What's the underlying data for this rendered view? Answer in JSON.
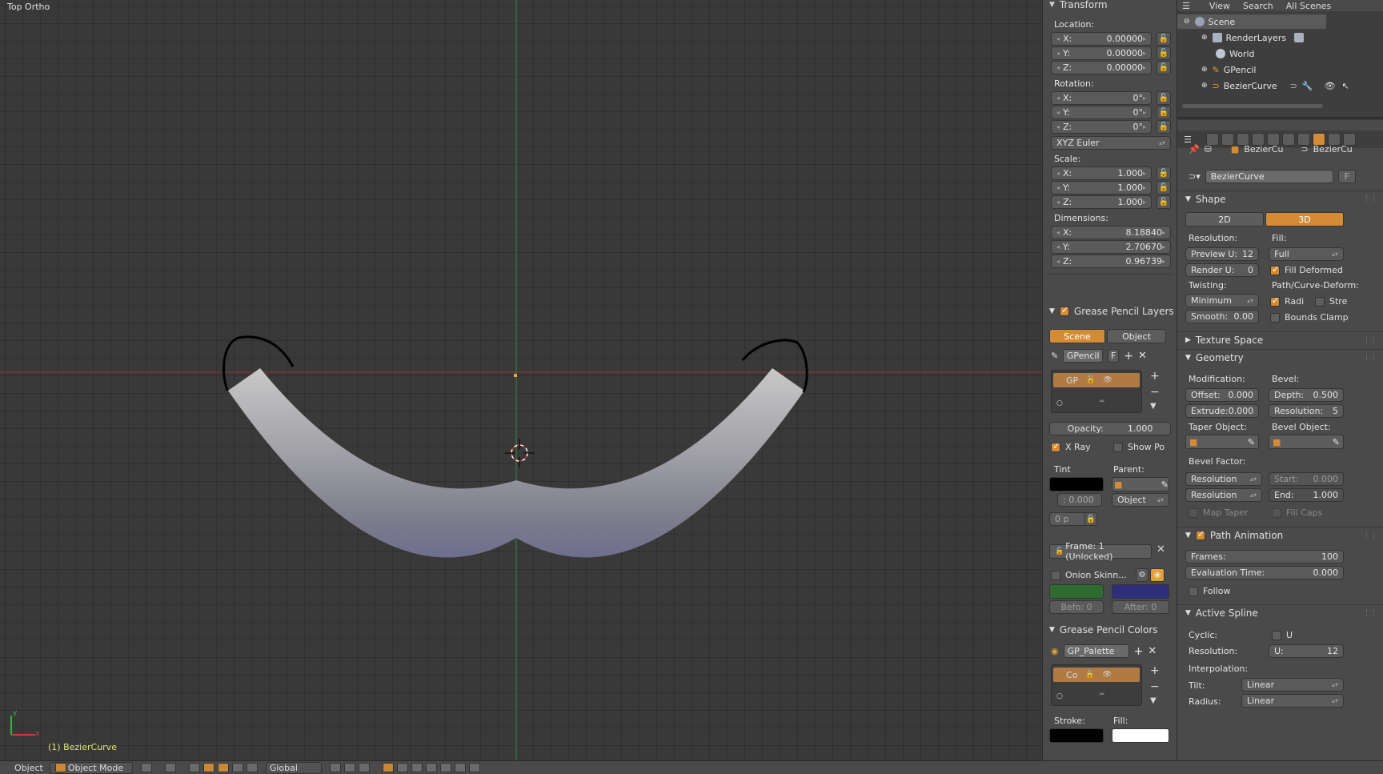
{
  "viewport": {
    "view_label": "Top Ortho",
    "object_label": "(1) BezierCurve",
    "axis_y": "y",
    "axis_x": "x"
  },
  "bottombar": {
    "menu_object": "Object",
    "mode": "Object Mode",
    "orientation": "Global"
  },
  "npanel": {
    "transform_title": "Transform",
    "location_label": "Location:",
    "location": [
      {
        "axis": "X:",
        "value": "0.00000"
      },
      {
        "axis": "Y:",
        "value": "0.00000"
      },
      {
        "axis": "Z:",
        "value": "0.00000"
      }
    ],
    "rotation_label": "Rotation:",
    "rotation": [
      {
        "axis": "X:",
        "value": "0°"
      },
      {
        "axis": "Y:",
        "value": "0°"
      },
      {
        "axis": "Z:",
        "value": "0°"
      }
    ],
    "rotation_mode": "XYZ Euler",
    "scale_label": "Scale:",
    "scale": [
      {
        "axis": "X:",
        "value": "1.000"
      },
      {
        "axis": "Y:",
        "value": "1.000"
      },
      {
        "axis": "Z:",
        "value": "1.000"
      }
    ],
    "dimensions_label": "Dimensions:",
    "dimensions": [
      {
        "axis": "X:",
        "value": "8.18840"
      },
      {
        "axis": "Y:",
        "value": "2.70670"
      },
      {
        "axis": "Z:",
        "value": "0.96739"
      }
    ],
    "gp_layers_title": "Grease Pencil Layers",
    "tab_scene": "Scene",
    "tab_object": "Object",
    "gp_name": "GPencil",
    "gp_f": "F",
    "layer_name": "GP",
    "opacity": "Opacity:",
    "opacity_value": "1.000",
    "xray": "X Ray",
    "show_po": "Show Po",
    "tint": "Tint",
    "parent": "Parent:",
    "tint_value": ": 0.000",
    "parent_type": "Object",
    "thickness": "0 p",
    "frame": "Frame: 1 (Unlocked)",
    "onion": "Onion Skinn...",
    "before": "Befo: 0",
    "after": "After: 0",
    "gp_colors_title": "Grease Pencil Colors",
    "palette": "GP_Palette",
    "color_name": "Co",
    "stroke": "Stroke:",
    "fill": "Fill:"
  },
  "outliner": {
    "menu_view": "View",
    "menu_search": "Search",
    "menu_scenes": "All Scenes",
    "rows": [
      {
        "name": "Scene"
      },
      {
        "name": "RenderLayers"
      },
      {
        "name": "World"
      },
      {
        "name": "GPencil"
      },
      {
        "name": "BezierCurve"
      }
    ]
  },
  "props": {
    "crumb1": "BezierCu",
    "crumb2": "BezierCu",
    "datablock": "BezierCurve",
    "datablock_f": "F",
    "shape": "Shape",
    "btn_2d": "2D",
    "btn_3d": "3D",
    "resolution": "Resolution:",
    "fill": "Fill:",
    "preview_u": "Preview U:",
    "preview_u_val": "12",
    "fill_mode": "Full",
    "render_u": "Render U:",
    "render_u_val": "0",
    "fill_deformed": "Fill Deformed",
    "twisting": "Twisting:",
    "path_deform": "Path/Curve-Deform:",
    "twist_mode": "Minimum",
    "radi": "Radi",
    "stre": "Stre",
    "smooth": "Smooth:",
    "smooth_val": "0.00",
    "bounds_clamp": "Bounds Clamp",
    "texture_space": "Texture Space",
    "geometry": "Geometry",
    "modification": "Modification:",
    "bevel": "Bevel:",
    "offset": "Offset:",
    "offset_val": "0.000",
    "depth": "Depth:",
    "depth_val": "0.500",
    "extrude": "Extrude:",
    "extrude_val": "0.000",
    "bevel_res": "Resolution:",
    "bevel_res_val": "5",
    "taper_obj": "Taper Object:",
    "bevel_obj": "Bevel Object:",
    "bevel_factor": "Bevel Factor:",
    "bf_res1": "Resolution",
    "bf_start": "Start:",
    "bf_start_val": "0.000",
    "bf_res2": "Resolution",
    "bf_end": "End:",
    "bf_end_val": "1.000",
    "map_taper": "Map Taper",
    "fill_caps": "Fill Caps",
    "path_animation": "Path Animation",
    "frames": "Frames:",
    "frames_val": "100",
    "eval_time": "Evaluation Time:",
    "eval_time_val": "0.000",
    "follow": "Follow",
    "active_spline": "Active Spline",
    "cyclic": "Cyclic:",
    "cyclic_u": "U",
    "spline_res": "Resolution:",
    "spline_u": "U:",
    "spline_u_val": "12",
    "interpolation": "Interpolation:",
    "tilt": "Tilt:",
    "tilt_val": "Linear",
    "radius": "Radius:",
    "radius_val": "Linear"
  },
  "colors": {
    "accent": "#d38b35",
    "x_axis": "#b13c3c",
    "y_axis": "#3c9a3c"
  }
}
